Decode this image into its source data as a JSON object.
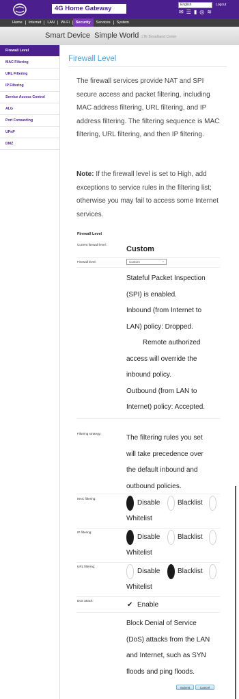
{
  "header": {
    "title": "4G Home Gateway",
    "language": "English",
    "logout": "Logout",
    "status_icons": [
      "mail-icon",
      "sms-icon",
      "signal-icon",
      "globe-icon",
      "wifi-icon"
    ]
  },
  "nav": {
    "items": [
      "Home",
      "Internet",
      "LAN",
      "Wi-Fi",
      "Security",
      "Services",
      "System"
    ],
    "active": "Security"
  },
  "banner": {
    "text": "Smart Device  Simple World",
    "tagline": "LTE Broadband Center"
  },
  "sidebar": {
    "items": [
      {
        "label": "Firewall Level",
        "active": true
      },
      {
        "label": "MAC Filtering",
        "active": false
      },
      {
        "label": "URL Filtering",
        "active": false
      },
      {
        "label": "IP Filtering",
        "active": false
      },
      {
        "label": "Service Access Control",
        "active": false
      },
      {
        "label": "ALG",
        "active": false
      },
      {
        "label": "Port Forwarding",
        "active": false
      },
      {
        "label": "UPnP",
        "active": false
      },
      {
        "label": "DMZ",
        "active": false
      }
    ]
  },
  "main": {
    "title": "Firewall Level",
    "description": "The firewall services provide NAT and SPI secure access and packet filtering, including MAC address filtering, URL filtering, and IP address filtering. The filtering sequence is MAC filtering, URL filtering, and then IP filtering.",
    "note_label": "Note:",
    "note_text": " If the firewall level is set to High, add exceptions to service rules in the filtering list; otherwise you may fail to access some Internet services.",
    "section_title": "Firewall Level",
    "current_level_label": "Current firewall level:",
    "current_level_value": "Custom",
    "firewall_level_label": "Firewall level:",
    "firewall_level_selected": "Custom",
    "spi_lines": [
      "Stateful Packet Inspection",
      "(SPI) is enabled.",
      "Inbound (from Internet to",
      "LAN) policy: Dropped.",
      "Remote authorized",
      "access will override the",
      "inbound policy.",
      "Outbound (from LAN to",
      "Internet) policy: Accepted."
    ],
    "filtering_strategy_label": "Filtering strategy:",
    "filtering_strategy_lines": [
      "The filtering rules you set",
      "will take precedence over",
      "the default inbound and",
      "outbound policies."
    ],
    "mac_filtering_label": "MAC filtering:",
    "ip_filtering_label": "IP filtering:",
    "url_filtering_label": "URL filtering:",
    "dos_label": "DoS attack:",
    "option_disable": "Disable",
    "option_blacklist": "Blacklist",
    "option_whitelist": "Whitelist",
    "mac_selected": "Disable",
    "ip_selected": "Disable",
    "url_selected": "Blacklist",
    "dos_enable": "Enable",
    "dos_enabled": true,
    "dos_lines": [
      "Block Denial of Service",
      "(DoS) attacks from the LAN",
      "and Internet, such as SYN",
      "floods and ping floods."
    ],
    "submit_label": "Submit",
    "cancel_label": "Cancel"
  },
  "colors": {
    "brand": "#4b1f8e",
    "title_blue": "#4aa3d7",
    "active_tab": "#7a3ab0"
  }
}
